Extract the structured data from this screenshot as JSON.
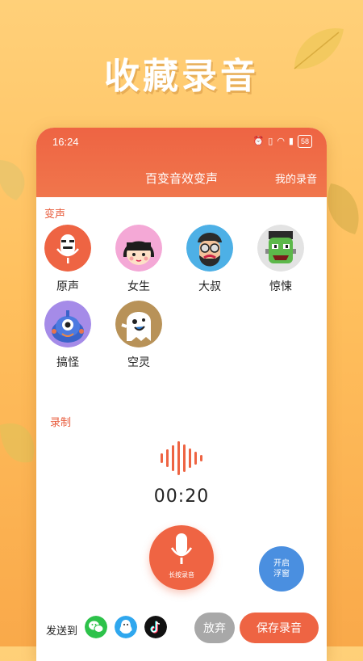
{
  "promo": {
    "title": "收藏录音"
  },
  "status_bar": {
    "time": "16:24",
    "battery": "58"
  },
  "header": {
    "title": "百变音效变声",
    "my_recordings": "我的录音"
  },
  "voice_section": {
    "label": "变声",
    "voices": [
      {
        "label": "原声",
        "icon": "microphone-face-avatar"
      },
      {
        "label": "女生",
        "icon": "girl-avatar"
      },
      {
        "label": "大叔",
        "icon": "uncle-avatar"
      },
      {
        "label": "惊悚",
        "icon": "monster-avatar"
      },
      {
        "label": "搞怪",
        "icon": "alien-avatar"
      },
      {
        "label": "空灵",
        "icon": "ghost-avatar"
      }
    ]
  },
  "record_section": {
    "label": "录制",
    "timer": "00:20",
    "record_button": "长按录音",
    "float_button": {
      "line1": "开启",
      "line2": "浮窗"
    }
  },
  "bottom_bar": {
    "send_to": "发送到",
    "share_targets": [
      "wechat-icon",
      "qq-icon",
      "tiktok-icon"
    ],
    "abandon": "放弃",
    "save": "保存录音"
  },
  "colors": {
    "accent": "#ee6443",
    "float_button": "#4a8fe0",
    "background": "#ffc05e"
  }
}
